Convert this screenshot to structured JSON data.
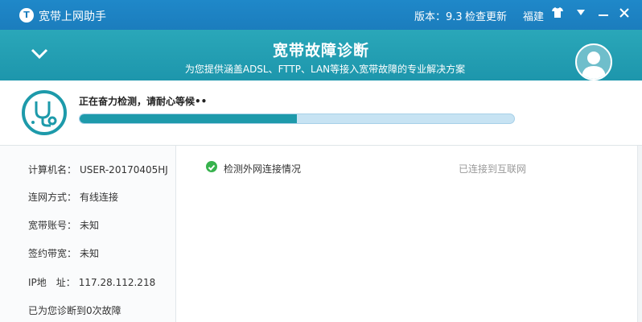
{
  "titlebar": {
    "logo_text": "T",
    "app_name": "宽带上网助手",
    "version": "版本：9.3",
    "check_update": "检查更新",
    "region": "福建",
    "icons": [
      "shirt-icon",
      "dropdown-icon",
      "minimize-icon",
      "close-icon"
    ]
  },
  "banner": {
    "title": "宽带故障诊断",
    "subtitle": "为您提供涵盖ADSL、FTTP、LAN等接入宽带故障的专业解决方案",
    "icons": [
      "chevron-down-icon",
      "avatar-icon"
    ]
  },
  "progress": {
    "status_text": "正在奋力检测，请耐心等候••",
    "fraction": 0.5,
    "icon": "stethoscope-icon"
  },
  "info": {
    "computer_name": {
      "label": "计算机名：",
      "value": "USER-20170405HJ"
    },
    "connection_type": {
      "label": "连网方式：",
      "value": "有线连接"
    },
    "account": {
      "label": "宽带账号：",
      "value": "未知"
    },
    "bandwidth": {
      "label": "签约带宽：",
      "value": "未知"
    },
    "ip": {
      "label": "IP地　址：",
      "value": "117.28.112.218"
    },
    "diagnosed": "已为您诊断到0次故障"
  },
  "checks": [
    {
      "label": "检测外网连接情况",
      "status": "已连接到互联网",
      "icon": "check-circle-icon"
    }
  ],
  "colors": {
    "titlebar": "#1b7dbd",
    "banner": "#23a0b3",
    "progress_fill": "#1e9aab",
    "progress_track": "#c7e3f3",
    "check_green": "#37b24d"
  }
}
